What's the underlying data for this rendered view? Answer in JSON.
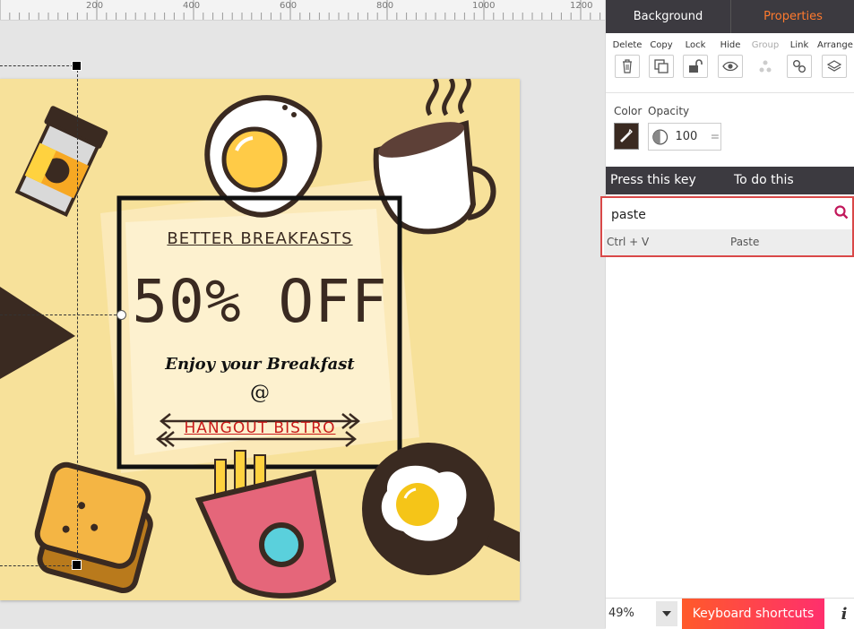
{
  "ruler": {
    "ticks": [
      "200",
      "400",
      "600",
      "800",
      "1000",
      "1200"
    ]
  },
  "poster": {
    "heading": "BETTER BREAKFASTS",
    "offer": "50% OFF",
    "tagline": "Enjoy your Breakfast",
    "at": "@",
    "venue": "HANGOUT BISTRO"
  },
  "panel": {
    "tabs": [
      {
        "label": "Background"
      },
      {
        "label": "Properties"
      }
    ],
    "tools": [
      {
        "label": "Delete",
        "icon": "trash-icon"
      },
      {
        "label": "Copy",
        "icon": "copy-icon"
      },
      {
        "label": "Lock",
        "icon": "lock-icon"
      },
      {
        "label": "Hide",
        "icon": "eye-icon"
      },
      {
        "label": "Group",
        "icon": "group-icon"
      },
      {
        "label": "Link",
        "icon": "link-icon"
      },
      {
        "label": "Arrange",
        "icon": "layers-icon"
      }
    ],
    "color_label": "Color",
    "opacity_label": "Opacity",
    "opacity_value": "100",
    "swatch_color": "#3a2a21"
  },
  "shortcuts": {
    "col_key": "Press this key",
    "col_action": "To do this",
    "search_value": "paste",
    "results": [
      {
        "key": "Ctrl + V",
        "action": "Paste"
      }
    ]
  },
  "bottom": {
    "zoom": "49%",
    "keyboard_button": "Keyboard shortcuts",
    "info": "i"
  },
  "colors": {
    "accent": "#ff7a2e",
    "panel_dark": "#3c3a40",
    "highlight": "#d94848",
    "poster_bg": "#f7e19a"
  }
}
